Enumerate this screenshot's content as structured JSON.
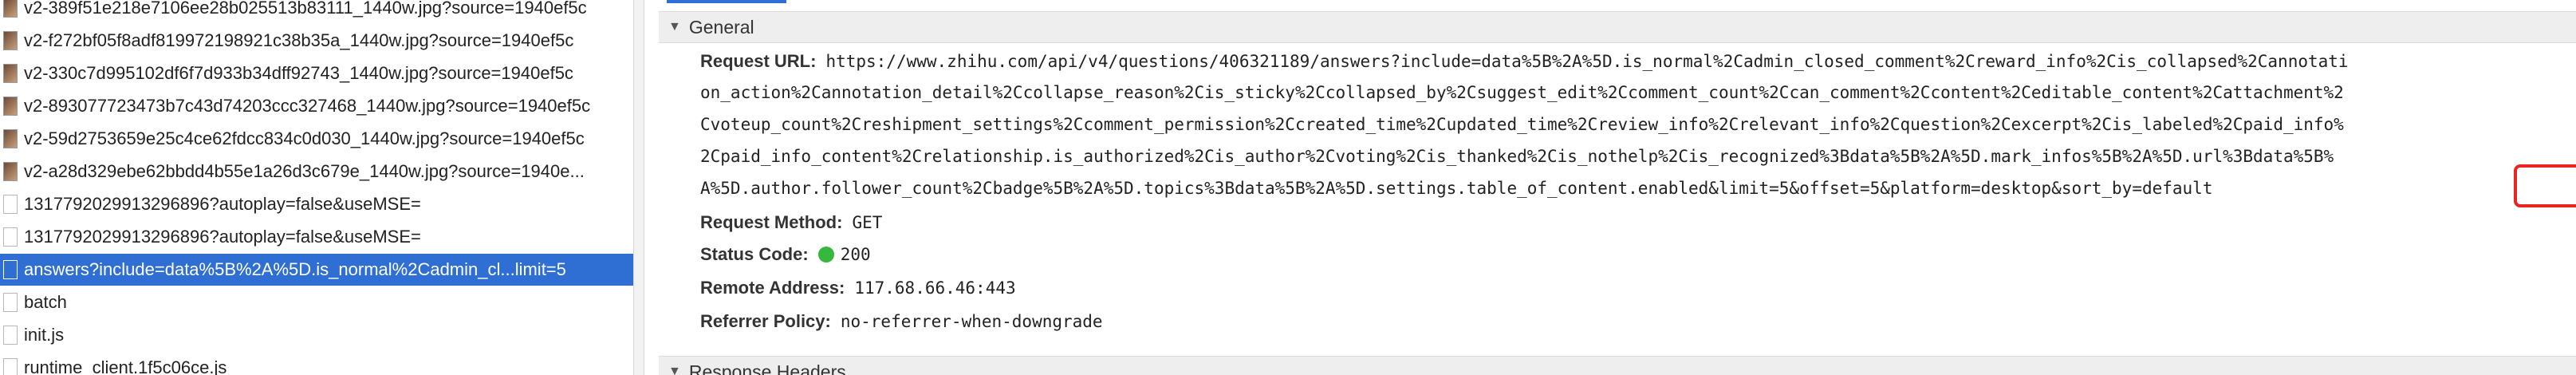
{
  "requests": [
    {
      "name": "v2-389f51e218e7106ee28b025513b83111_1440w.jpg?source=1940ef5c",
      "icon": "image-thumbnail-icon",
      "selected": false
    },
    {
      "name": "v2-f272bf05f8adf819972198921c38b35a_1440w.jpg?source=1940ef5c",
      "icon": "image-thumbnail-icon",
      "selected": false
    },
    {
      "name": "v2-330c7d995102df6f7d933b34dff92743_1440w.jpg?source=1940ef5c",
      "icon": "image-thumbnail-icon",
      "selected": false
    },
    {
      "name": "v2-893077723473b7c43d74203ccc327468_1440w.jpg?source=1940ef5c",
      "icon": "image-thumbnail-icon",
      "selected": false
    },
    {
      "name": "v2-59d2753659e25c4ce62fdcc834c0d030_1440w.jpg?source=1940ef5c",
      "icon": "image-thumbnail-icon",
      "selected": false
    },
    {
      "name": "v2-a28d329ebe62bbdd4b55e1a26d3c679e_1440w.jpg?source=1940e...",
      "icon": "image-thumbnail-icon",
      "selected": false
    },
    {
      "name": "1317792029913296896?autoplay=false&useMSE=",
      "icon": "file-icon",
      "selected": false
    },
    {
      "name": "1317792029913296896?autoplay=false&useMSE=",
      "icon": "file-icon",
      "selected": false
    },
    {
      "name": "answers?include=data%5B%2A%5D.is_normal%2Cadmin_cl...limit=5",
      "icon": "file-icon",
      "selected": true
    },
    {
      "name": "batch",
      "icon": "file-icon",
      "selected": false
    },
    {
      "name": "init.js",
      "icon": "file-icon",
      "selected": false
    },
    {
      "name": "runtime_client.1f5c06ce.js",
      "icon": "file-icon",
      "selected": false
    }
  ],
  "general": {
    "header": "General",
    "url_key": "Request URL:",
    "url_lines": [
      "https://www.zhihu.com/api/v4/questions/406321189/answers?include=data%5B%2A%5D.is_normal%2Cadmin_closed_comment%2Creward_info%2Cis_collapsed%2Cannotati",
      "on_action%2Cannotation_detail%2Ccollapse_reason%2Cis_sticky%2Ccollapsed_by%2Csuggest_edit%2Ccomment_count%2Ccan_comment%2Ccontent%2Ceditable_content%2Cattachment%2",
      "Cvoteup_count%2Creshipment_settings%2Ccomment_permission%2Ccreated_time%2Cupdated_time%2Creview_info%2Crelevant_info%2Cquestion%2Cexcerpt%2Cis_labeled%2Cpaid_info%",
      "2Cpaid_info_content%2Crelationship.is_authorized%2Cis_author%2Cvoting%2Cis_thanked%2Cis_nothelp%2Cis_recognized%3Bdata%5B%2A%5D.mark_infos%5B%2A%5D.url%3Bdata%5B%",
      "A%5D.author.follower_count%2Cbadge%5B%2A%5D.topics%3Bdata%5B%2A%5D.settings.table_of_content.enabled&limit=5&offset=5&platform=desktop&sort_by=default"
    ],
    "method_key": "Request Method:",
    "method": "GET",
    "status_key": "Status Code:",
    "status": "200",
    "status_color": "#35b83c",
    "remote_key": "Remote Address:",
    "remote": "117.68.66.46:443",
    "referrer_key": "Referrer Policy:",
    "referrer": "no-referrer-when-downgrade"
  },
  "response_headers": {
    "header": "Response Headers"
  },
  "colors": {
    "selection": "#2f6fd3",
    "highlight": "#e8261f"
  }
}
